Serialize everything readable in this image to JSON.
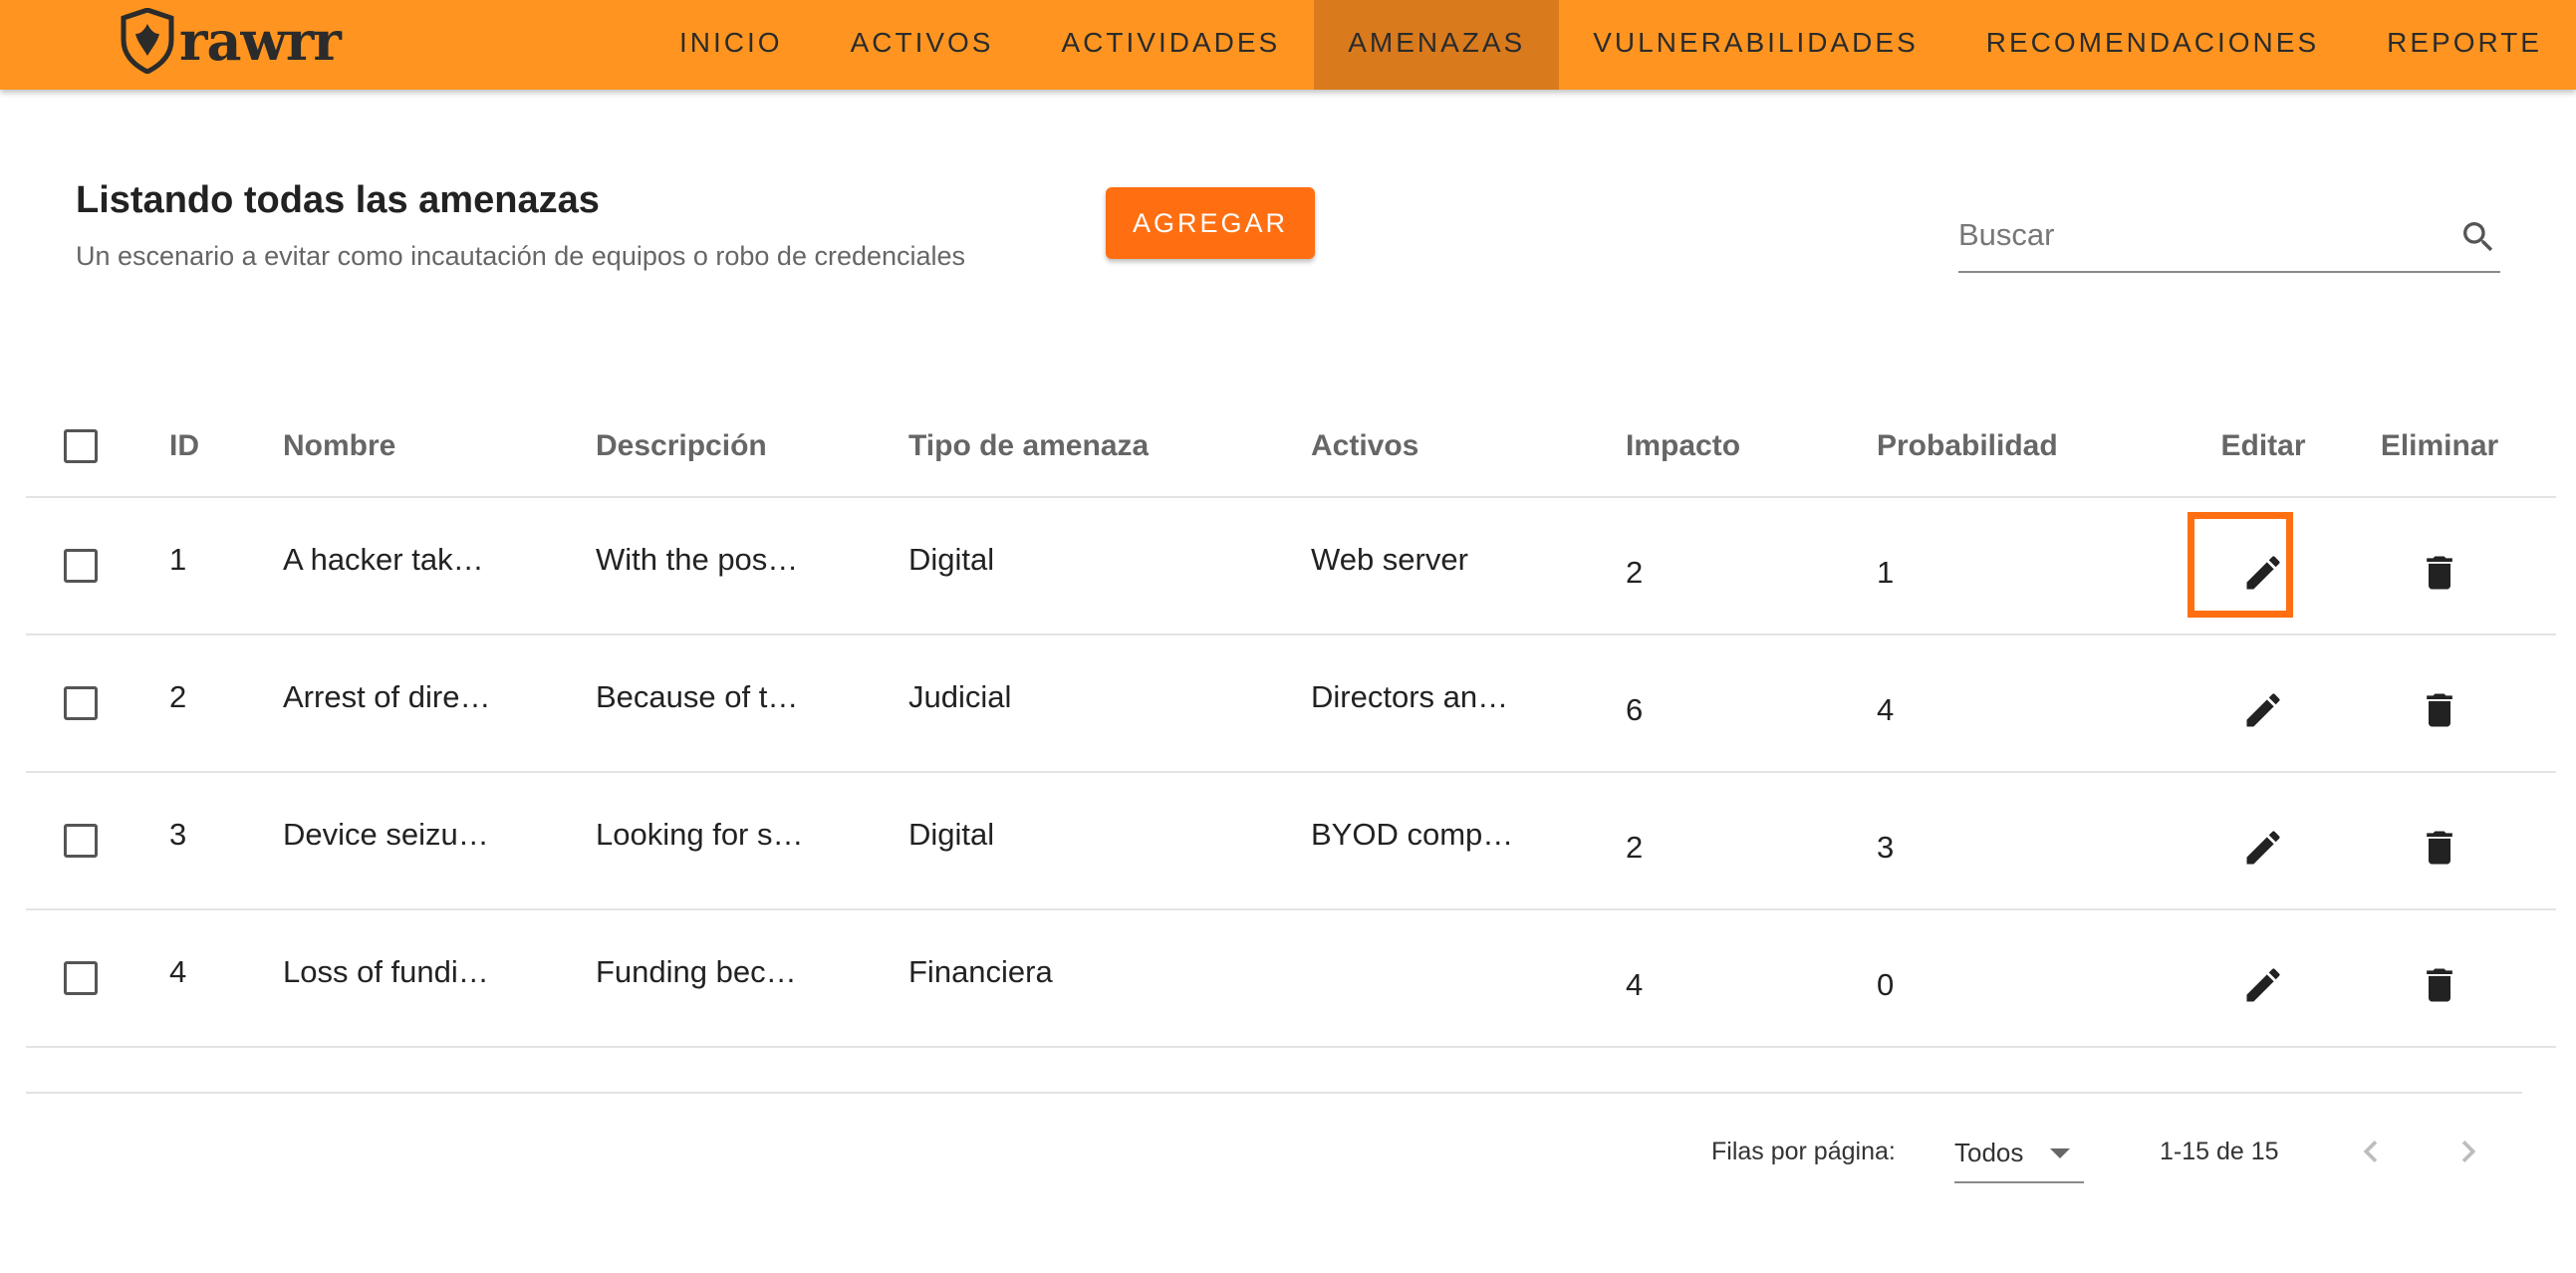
{
  "app": {
    "logo_text": "rawrr"
  },
  "nav": {
    "items": [
      "INICIO",
      "ACTIVOS",
      "ACTIVIDADES",
      "AMENAZAS",
      "VULNERABILIDADES",
      "RECOMENDACIONES",
      "REPORTE"
    ],
    "active": "AMENAZAS"
  },
  "header": {
    "title": "Listando todas las amenazas",
    "subtitle": "Un escenario a evitar como incautación de equipos o robo de credenciales",
    "add_label": "AGREGAR"
  },
  "search": {
    "placeholder": "Buscar",
    "value": ""
  },
  "table": {
    "columns": [
      "ID",
      "Nombre",
      "Descripción",
      "Tipo de amenaza",
      "Activos",
      "Impacto",
      "Probabilidad",
      "Editar",
      "Eliminar"
    ],
    "rows": [
      {
        "id": "1",
        "name": "A hacker tak…",
        "description": "With the pos…",
        "type": "Digital",
        "assets": "Web server",
        "impact": "2",
        "probability": "1"
      },
      {
        "id": "2",
        "name": "Arrest of dire…",
        "description": "Because of t…",
        "type": "Judicial",
        "assets": "Directors an…",
        "impact": "6",
        "probability": "4"
      },
      {
        "id": "3",
        "name": "Device seizu…",
        "description": "Looking for s…",
        "type": "Digital",
        "assets": "BYOD comp…",
        "impact": "2",
        "probability": "3"
      },
      {
        "id": "4",
        "name": "Loss of fundi…",
        "description": "Funding bec…",
        "type": "Financiera",
        "assets": "",
        "impact": "4",
        "probability": "0"
      }
    ]
  },
  "footer": {
    "rows_per_page_label": "Filas por página:",
    "rows_per_page_value": "Todos",
    "range": "1-15 de 15"
  },
  "colors": {
    "nav_bg": "#ff9520",
    "nav_active": "#d97a1c",
    "accent": "#ff6f12"
  },
  "icons": {
    "search": "search-icon",
    "edit": "pencil-icon",
    "delete": "trash-icon",
    "prev": "chevron-left-icon",
    "next": "chevron-right-icon"
  }
}
